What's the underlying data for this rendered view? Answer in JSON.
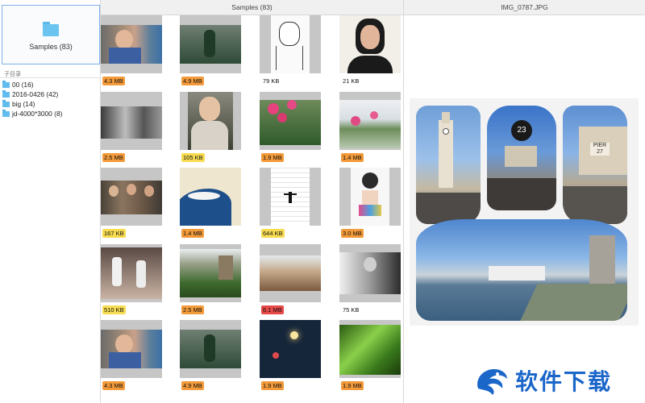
{
  "sidebar": {
    "root": {
      "label": "Samples (83)"
    },
    "subdir_title": "子目录",
    "items": [
      {
        "label": "00 (16)"
      },
      {
        "label": "2016-0426 (42)"
      },
      {
        "label": "big (14)"
      },
      {
        "label": "jd-4000*3000 (8)"
      }
    ]
  },
  "grid": {
    "title": "Samples (83)",
    "cells": [
      {
        "size": "4.3 MB",
        "badge": "orange",
        "icon": "photo-kid"
      },
      {
        "size": "4.9 MB",
        "badge": "orange",
        "icon": "photo-green-figure"
      },
      {
        "size": "79 KB",
        "badge": "none",
        "icon": "sketch-man"
      },
      {
        "size": "21 KB",
        "badge": "none",
        "icon": "portrait-woman"
      },
      {
        "size": "2.5 MB",
        "badge": "orange",
        "icon": "bw-group"
      },
      {
        "size": "105 KB",
        "badge": "yellow",
        "icon": "photo-woman"
      },
      {
        "size": "1.9 MB",
        "badge": "orange",
        "icon": "pink-flowers"
      },
      {
        "size": "1.4 MB",
        "badge": "orange",
        "icon": "pink-flower-lake"
      },
      {
        "size": "167 KB",
        "badge": "yellow",
        "icon": "three-men"
      },
      {
        "size": "1.4 MB",
        "badge": "orange",
        "icon": "great-wave"
      },
      {
        "size": "644 KB",
        "badge": "yellow",
        "icon": "figure-grid"
      },
      {
        "size": "3.0 MB",
        "badge": "orange",
        "icon": "anime-girl"
      },
      {
        "size": "510 KB",
        "badge": "yellow",
        "icon": "dancers"
      },
      {
        "size": "2.5 MB",
        "badge": "orange",
        "icon": "ruins-grass"
      },
      {
        "size": "6.1 MB",
        "badge": "red",
        "icon": "rock-field"
      },
      {
        "size": "75 KB",
        "badge": "none",
        "icon": "bw-man"
      },
      {
        "size": "4.3 MB",
        "badge": "orange",
        "icon": "photo-kid"
      },
      {
        "size": "4.9 MB",
        "badge": "orange",
        "icon": "photo-green-figure"
      },
      {
        "size": "1.9 MB",
        "badge": "orange",
        "icon": "night-lights"
      },
      {
        "size": "1.9 MB",
        "badge": "orange",
        "icon": "grass-closeup"
      }
    ]
  },
  "preview": {
    "title": "IMG_0787.JPG"
  },
  "watermark": {
    "text": "软件下载"
  },
  "colors": {
    "badge_orange": "#f39a3a",
    "badge_yellow": "#f7dc52",
    "badge_red": "#e64848",
    "folder": "#62bdee",
    "selection": "#7fb0e6"
  }
}
